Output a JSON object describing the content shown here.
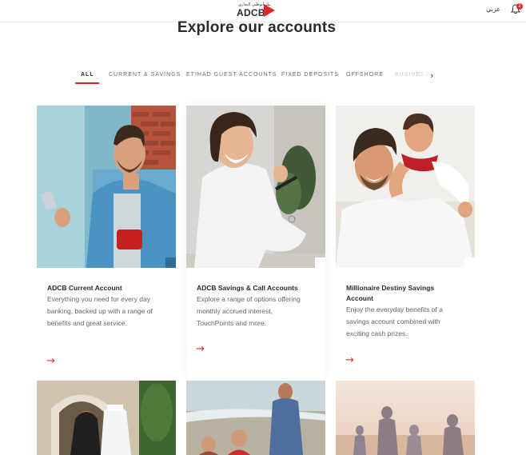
{
  "header": {
    "logo_arabic": "بنك أبوظبي التجاري",
    "logo_text": "ADCB",
    "language_link": "عربي",
    "notification_count": "2"
  },
  "page": {
    "title": "Explore our accounts"
  },
  "tabs": [
    {
      "label": "ALL",
      "active": true
    },
    {
      "label": "CURRENT & SAVINGS",
      "active": false
    },
    {
      "label": "ETIHAD GUEST ACCOUNTS",
      "active": false
    },
    {
      "label": "FIXED DEPOSITS",
      "active": false
    },
    {
      "label": "OFFSHORE",
      "active": false
    },
    {
      "label": "BUSINESS A",
      "active": false
    }
  ],
  "cards": [
    {
      "title": "ADCB Current Account",
      "description": "Everything you need for every day banking, backed up with a range of benefits and great service.",
      "arrow": "→"
    },
    {
      "title": "ADCB Savings & Call Accounts",
      "description": "Explore a range of options offering monthly accrued interest, TouchPoints and more.",
      "arrow": "→"
    },
    {
      "title": "Millionaire Destiny Savings Account",
      "description": "Enjoy the everyday benefits of a savings account combined with exciting cash prizes.",
      "arrow": "→"
    }
  ],
  "colors": {
    "accent": "#e0262d",
    "text": "#2b2b2b",
    "muted": "#666666"
  }
}
